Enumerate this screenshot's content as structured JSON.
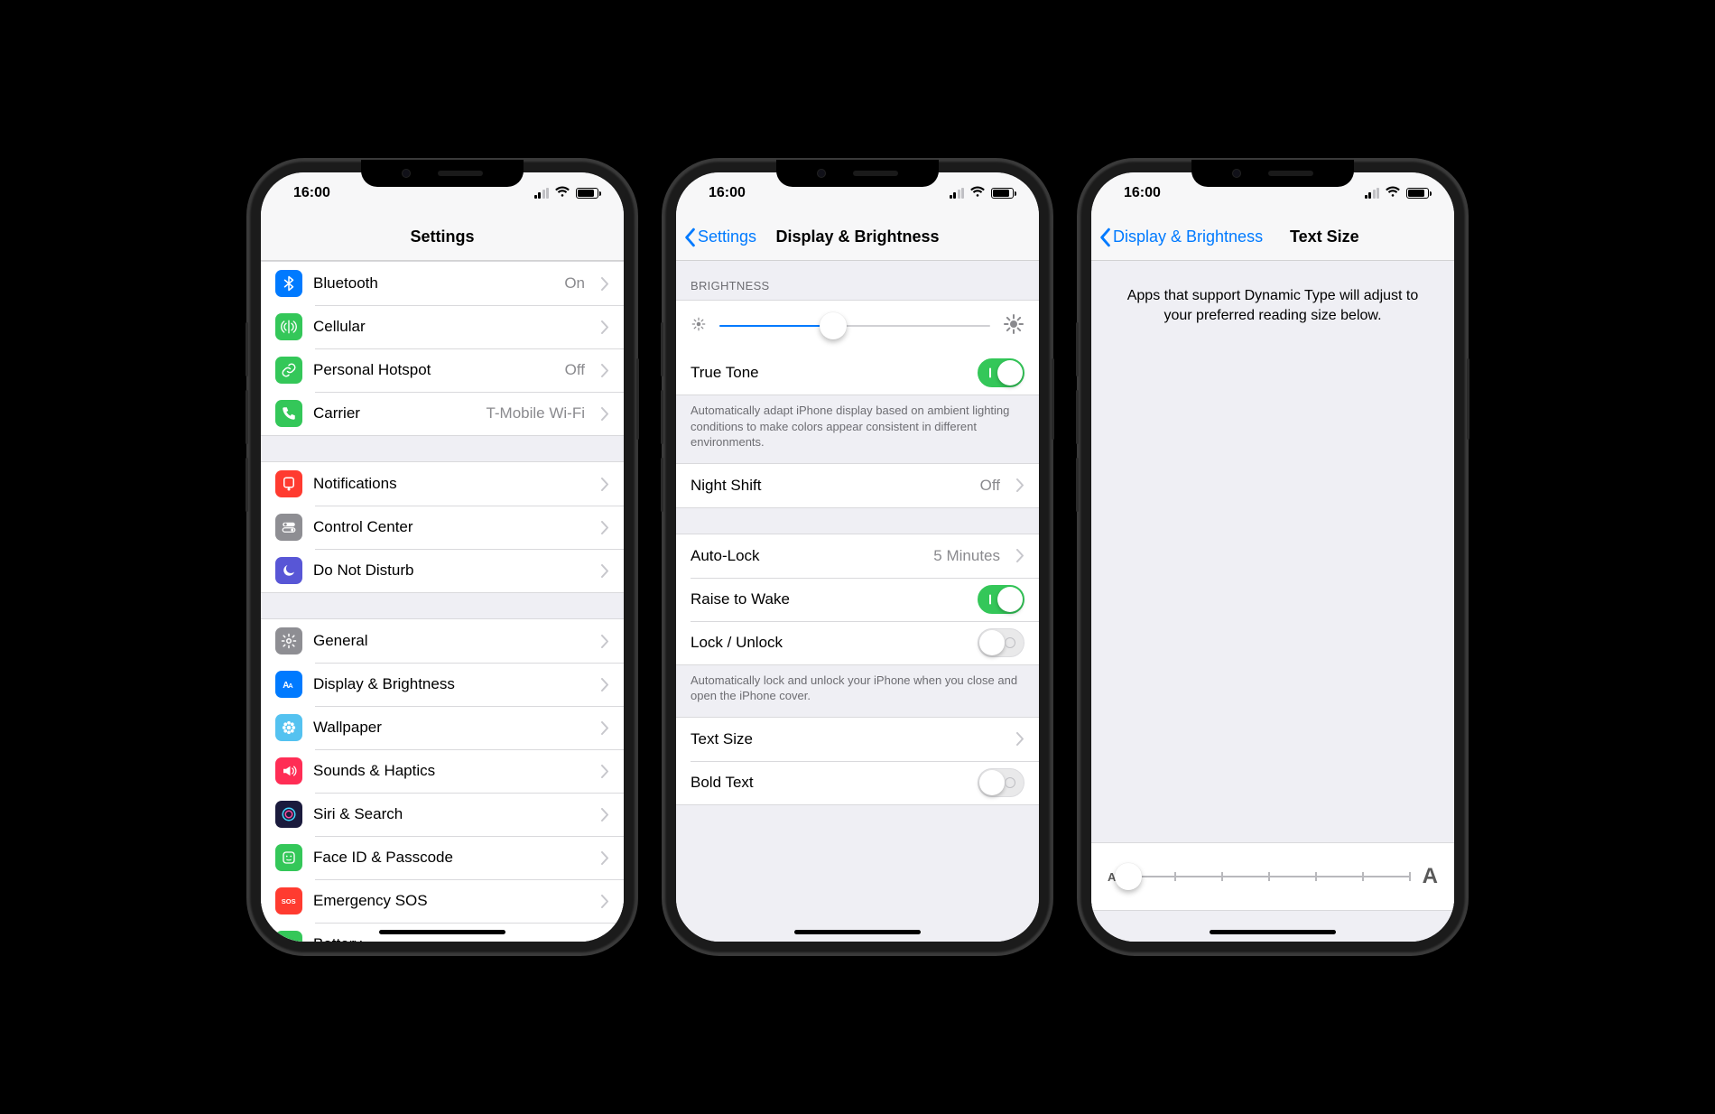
{
  "status": {
    "time": "16:00"
  },
  "screen1": {
    "title": "Settings",
    "groups": [
      [
        {
          "key": "bluetooth",
          "label": "Bluetooth",
          "value": "On",
          "icon": "bluetooth",
          "color": "#007aff"
        },
        {
          "key": "cellular",
          "label": "Cellular",
          "icon": "antenna",
          "color": "#34c759"
        },
        {
          "key": "hotspot",
          "label": "Personal Hotspot",
          "value": "Off",
          "icon": "link",
          "color": "#34c759"
        },
        {
          "key": "carrier",
          "label": "Carrier",
          "value": "T-Mobile Wi-Fi",
          "icon": "phone",
          "color": "#34c759"
        }
      ],
      [
        {
          "key": "notifications",
          "label": "Notifications",
          "icon": "bell-square",
          "color": "#ff3b30"
        },
        {
          "key": "controlcenter",
          "label": "Control Center",
          "icon": "switches",
          "color": "#8e8e93"
        },
        {
          "key": "dnd",
          "label": "Do Not Disturb",
          "icon": "moon",
          "color": "#5856d6"
        }
      ],
      [
        {
          "key": "general",
          "label": "General",
          "icon": "gear",
          "color": "#8e8e93"
        },
        {
          "key": "display",
          "label": "Display & Brightness",
          "icon": "AA",
          "color": "#007aff"
        },
        {
          "key": "wallpaper",
          "label": "Wallpaper",
          "icon": "flower",
          "color": "#54c2f0"
        },
        {
          "key": "sounds",
          "label": "Sounds & Haptics",
          "icon": "speaker",
          "color": "#ff2d55"
        },
        {
          "key": "siri",
          "label": "Siri & Search",
          "icon": "siri",
          "color": "#1b1b3d"
        },
        {
          "key": "faceid",
          "label": "Face ID & Passcode",
          "icon": "face",
          "color": "#34c759"
        },
        {
          "key": "sos",
          "label": "Emergency SOS",
          "icon": "SOS",
          "color": "#ff3b30"
        },
        {
          "key": "battery",
          "label": "Battery",
          "icon": "battery",
          "color": "#34c759"
        }
      ]
    ]
  },
  "screen2": {
    "back": "Settings",
    "title": "Display & Brightness",
    "brightness_header": "BRIGHTNESS",
    "brightness_pct": 42,
    "true_tone": {
      "label": "True Tone",
      "on": true
    },
    "true_tone_note": "Automatically adapt iPhone display based on ambient lighting conditions to make colors appear consistent in different environments.",
    "night_shift": {
      "label": "Night Shift",
      "value": "Off"
    },
    "auto_lock": {
      "label": "Auto-Lock",
      "value": "5 Minutes"
    },
    "raise_to_wake": {
      "label": "Raise to Wake",
      "on": true
    },
    "lock_unlock": {
      "label": "Lock / Unlock",
      "on": false
    },
    "lock_note": "Automatically lock and unlock your iPhone when you close and open the iPhone cover.",
    "text_size": {
      "label": "Text Size"
    },
    "bold_text": {
      "label": "Bold Text",
      "on": false
    }
  },
  "screen3": {
    "back": "Display & Brightness",
    "title": "Text Size",
    "body": "Apps that support Dynamic Type will adjust to your preferred reading size below.",
    "slider_steps": 7,
    "slider_value": 0,
    "small_label": "A",
    "big_label": "A"
  }
}
